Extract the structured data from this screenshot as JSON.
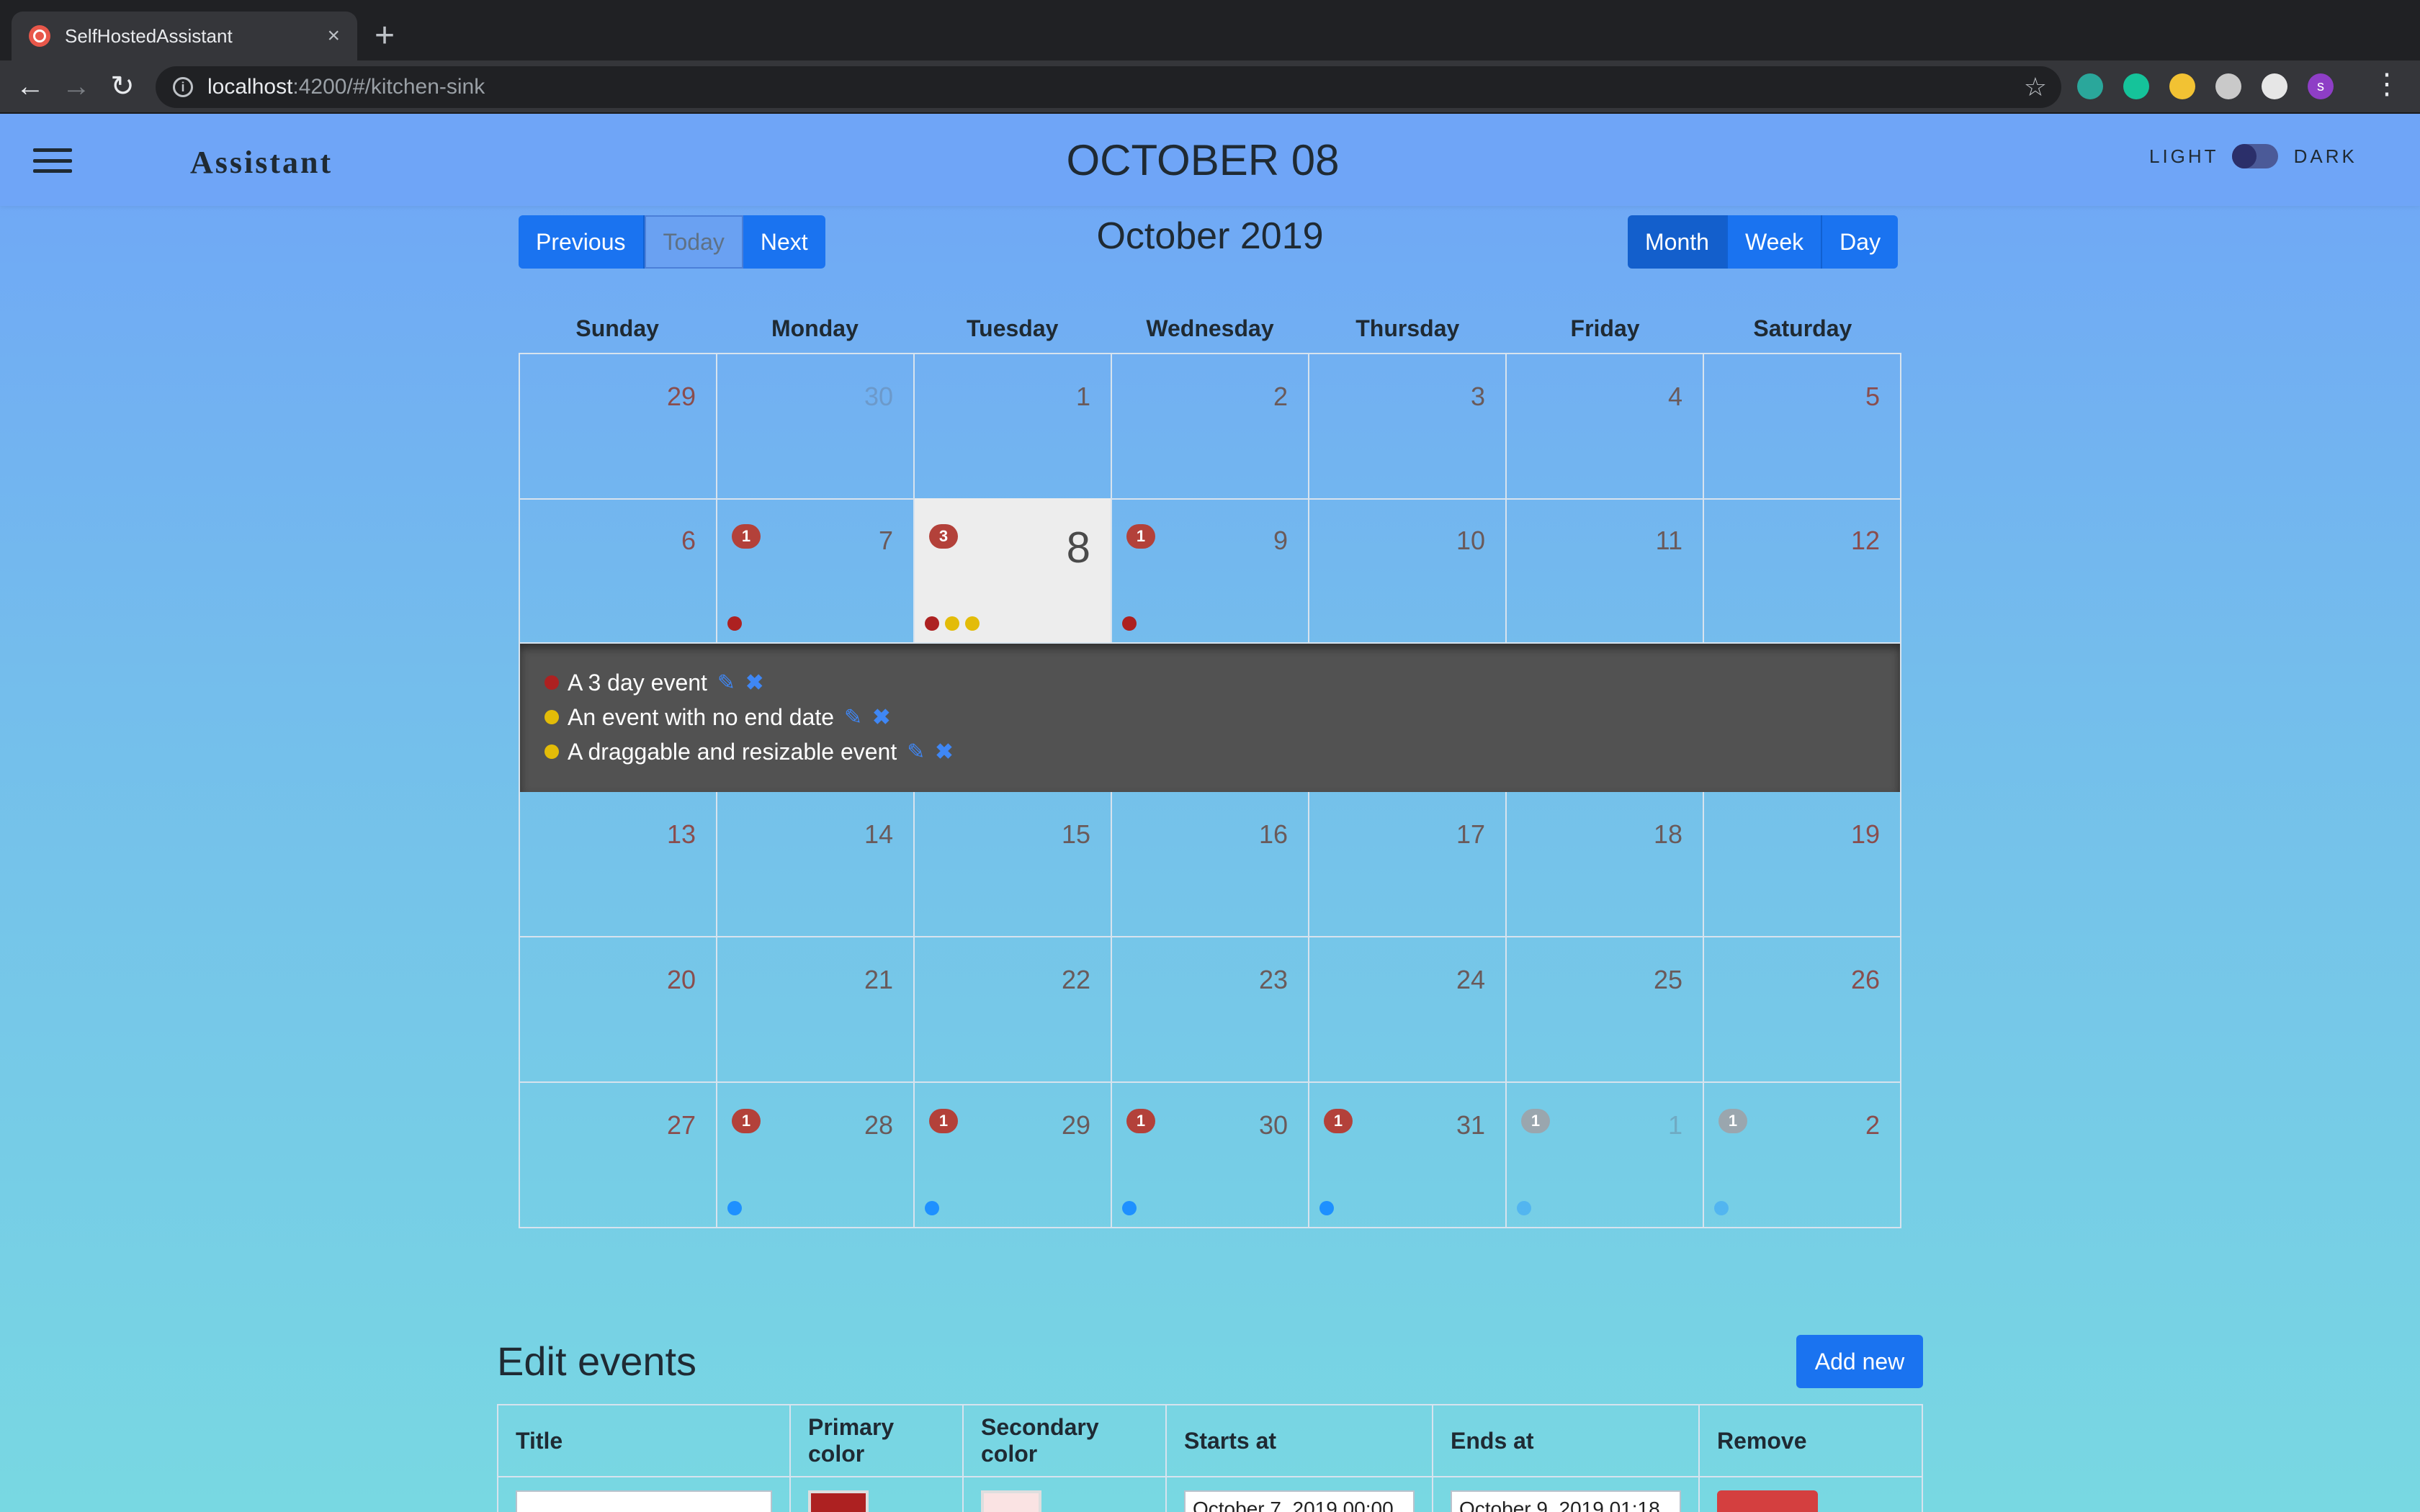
{
  "browser": {
    "tab_title": "SelfHostedAssistant",
    "tab_close": "×",
    "new_tab": "+",
    "url_host": "localhost",
    "url_path": ":4200/#/kitchen-sink",
    "back": "←",
    "forward": "→",
    "reload": "↻",
    "star": "☆",
    "menu": "⋮",
    "extensions": [
      {
        "icon": "extension-teal-icon",
        "color": "#2aa79b"
      },
      {
        "icon": "grammarly-icon",
        "color": "#15c39a"
      },
      {
        "icon": "extension-yellow-icon",
        "color": "#f2c233"
      },
      {
        "icon": "extension-gray-icon",
        "color": "#c9c9c9"
      },
      {
        "icon": "extension-white-icon",
        "color": "#e6e6e6"
      },
      {
        "icon": "profile-avatar-icon",
        "color": "#8e3ec6",
        "letter": "s"
      }
    ]
  },
  "header": {
    "brand": "Assistant",
    "date": "OCTOBER 08",
    "theme_light": "LIGHT",
    "theme_dark": "DARK"
  },
  "calendar": {
    "nav": [
      "Previous",
      "Today",
      "Next"
    ],
    "title": "October 2019",
    "views": [
      "Month",
      "Week",
      "Day"
    ],
    "active_view": "Month",
    "weekdays": [
      "Sunday",
      "Monday",
      "Tuesday",
      "Wednesday",
      "Thursday",
      "Friday",
      "Saturday"
    ],
    "colors": {
      "red": "#ad2121",
      "yellow": "#e3bc08",
      "blue": "#1e90ff"
    },
    "weeks": [
      [
        {
          "d": "29",
          "m": true
        },
        {
          "d": "30",
          "m": true
        },
        {
          "d": "1"
        },
        {
          "d": "2"
        },
        {
          "d": "3"
        },
        {
          "d": "4"
        },
        {
          "d": "5"
        }
      ],
      [
        {
          "d": "6"
        },
        {
          "d": "7",
          "badge": "1",
          "dots": [
            "#ad2121"
          ]
        },
        {
          "d": "8",
          "today": true,
          "badge": "3",
          "dots": [
            "#ad2121",
            "#e3bc08",
            "#e3bc08"
          ]
        },
        {
          "d": "9",
          "badge": "1",
          "dots": [
            "#ad2121"
          ]
        },
        {
          "d": "10"
        },
        {
          "d": "11"
        },
        {
          "d": "12"
        }
      ],
      [
        {
          "d": "13"
        },
        {
          "d": "14"
        },
        {
          "d": "15"
        },
        {
          "d": "16"
        },
        {
          "d": "17"
        },
        {
          "d": "18"
        },
        {
          "d": "19"
        }
      ],
      [
        {
          "d": "20"
        },
        {
          "d": "21"
        },
        {
          "d": "22"
        },
        {
          "d": "23"
        },
        {
          "d": "24"
        },
        {
          "d": "25"
        },
        {
          "d": "26"
        }
      ],
      [
        {
          "d": "27"
        },
        {
          "d": "28",
          "badge": "1",
          "dots": [
            "#1e90ff"
          ]
        },
        {
          "d": "29",
          "badge": "1",
          "dots": [
            "#1e90ff"
          ]
        },
        {
          "d": "30",
          "badge": "1",
          "dots": [
            "#1e90ff"
          ]
        },
        {
          "d": "31",
          "badge": "1",
          "dots": [
            "#1e90ff"
          ]
        },
        {
          "d": "1",
          "m": true,
          "badge": "1",
          "dots": [
            "#1e90ff"
          ]
        },
        {
          "d": "2",
          "m": true,
          "badge": "1",
          "dots": [
            "#1e90ff"
          ]
        }
      ]
    ],
    "open_week_index": 1,
    "open_events": [
      {
        "title": "A 3 day event",
        "color": "#ad2121"
      },
      {
        "title": "An event with no end date",
        "color": "#e3bc08"
      },
      {
        "title": "A draggable and resizable event",
        "color": "#e3bc08"
      }
    ]
  },
  "edit": {
    "title": "Edit events",
    "add_new": "Add new",
    "columns": [
      "Title",
      "Primary color",
      "Secondary color",
      "Starts at",
      "Ends at",
      "Remove"
    ],
    "row": {
      "title": "",
      "primary": "#ad2121",
      "secondary": "#fae3e3",
      "starts": "October 7, 2019 00:00",
      "ends": "October 9, 2019 01:18"
    }
  }
}
